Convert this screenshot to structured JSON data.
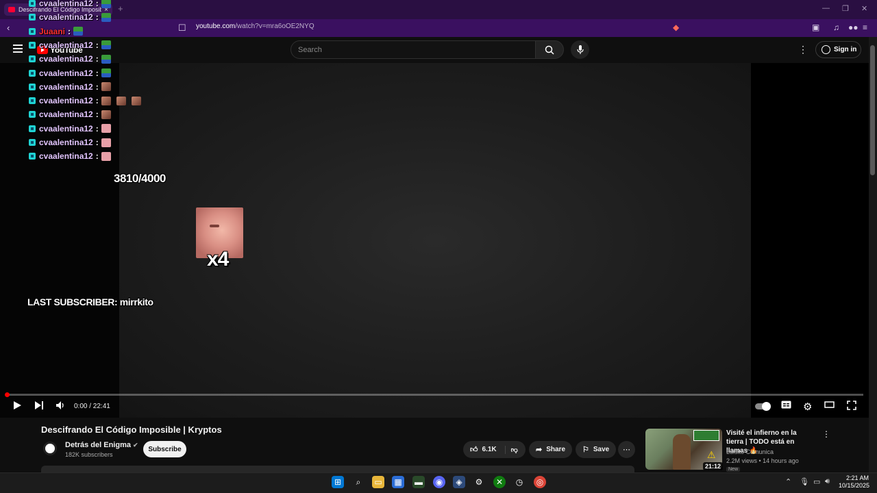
{
  "browser": {
    "tab_title": "Descifrando El Código Imposible",
    "tab_close": "×",
    "new_tab": "+",
    "url_host": "youtube.com",
    "url_path": "/watch?v=mra6oOE2NYQ",
    "win_minimize": "—",
    "win_restore": "❐",
    "win_close": "✕"
  },
  "header": {
    "logo_text": "YouTube",
    "search_placeholder": "Search",
    "sign_in": "Sign in"
  },
  "overlay": {
    "chat": [
      {
        "user": "cvaalentina12",
        "emotes": [
          "pepe"
        ],
        "color": "#e3c6ff"
      },
      {
        "user": "cvaalentina12",
        "emotes": [
          "pepe"
        ],
        "color": "#e3c6ff"
      },
      {
        "user": "Juaani",
        "emotes": [
          "pepe"
        ],
        "color": "#ff3030"
      },
      {
        "user": "cvaalentina12",
        "emotes": [
          "pepe"
        ],
        "color": "#e3c6ff"
      },
      {
        "user": "cvaalentina12",
        "emotes": [
          "pepe"
        ],
        "color": "#e3c6ff"
      },
      {
        "user": "cvaalentina12",
        "emotes": [
          "pepe"
        ],
        "color": "#e3c6ff"
      },
      {
        "user": "cvaalentina12",
        "emotes": [
          "face"
        ],
        "color": "#e3c6ff"
      },
      {
        "user": "cvaalentina12",
        "emotes": [
          "face",
          "face",
          "face"
        ],
        "color": "#e3c6ff"
      },
      {
        "user": "cvaalentina12",
        "emotes": [
          "face"
        ],
        "color": "#e3c6ff"
      },
      {
        "user": "cvaalentina12",
        "emotes": [
          "pink"
        ],
        "color": "#e3c6ff"
      },
      {
        "user": "cvaalentina12",
        "emotes": [
          "pink"
        ],
        "color": "#e3c6ff"
      },
      {
        "user": "cvaalentina12",
        "emotes": [
          "pink"
        ],
        "color": "#e3c6ff"
      }
    ],
    "chat_separator": ":",
    "goal_text": "3810/4000",
    "multiplier": "x4",
    "last_subscriber": "LAST SUBSCRIBER: mirrkito"
  },
  "player": {
    "time": "0:00 / 22:41",
    "progress_fraction": 0.0,
    "accent_color": "#ff0000"
  },
  "video": {
    "title": "Descifrando El Código Imposible | Kryptos",
    "channel": "Detrás del Enigma",
    "verified": "✔",
    "subscribers": "182K subscribers",
    "subscribe": "Subscribe",
    "likes": "6.1K",
    "share": "Share",
    "save": "Save"
  },
  "recommendation": {
    "title": "Visité el infierno en la tierra | TODO está en llamas 🔥",
    "channel": "Luisito Comunica",
    "meta": "2.2M views • 14 hours ago",
    "duration": "21:12",
    "badge": "New"
  },
  "taskbar": {
    "time": "2:21 AM",
    "date": "10/15/2025"
  }
}
